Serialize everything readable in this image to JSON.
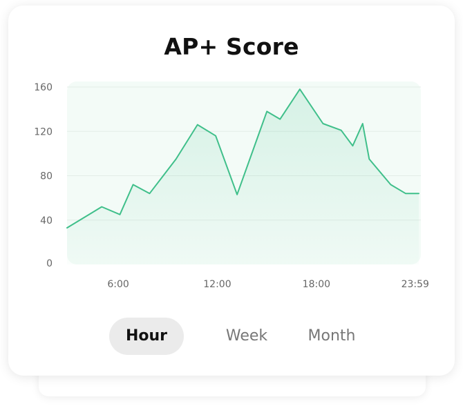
{
  "title": "AP+ Score",
  "tabs": [
    {
      "label": "Hour",
      "active": true
    },
    {
      "label": "Week",
      "active": false
    },
    {
      "label": "Month",
      "active": false
    }
  ],
  "colors": {
    "line": "#3fbf8a",
    "area": "#3fbf8a",
    "plot_bg": "#f3fbf7",
    "grid": "#e3ece7"
  },
  "chart_data": {
    "type": "area",
    "title": "AP+ Score",
    "xlabel": "",
    "ylabel": "",
    "ylim": [
      0,
      165
    ],
    "yticks": [
      0,
      40,
      80,
      120,
      160
    ],
    "ytick_labels": [
      "0",
      "40",
      "80",
      "120",
      "160"
    ],
    "xticks": [
      6,
      12,
      18,
      23.98
    ],
    "xtick_labels": [
      "6:00",
      "12:00",
      "18:00",
      "23:59"
    ],
    "xlim": [
      2.9,
      24.2
    ],
    "x": [
      2.9,
      5.0,
      6.1,
      6.9,
      7.9,
      9.5,
      10.8,
      11.9,
      13.2,
      15.0,
      15.8,
      17.0,
      18.4,
      19.5,
      20.2,
      20.8,
      21.2,
      22.5,
      23.4,
      24.2
    ],
    "series": [
      {
        "values": [
          33,
          52,
          45,
          72,
          64,
          95,
          126,
          116,
          63,
          138,
          131,
          158,
          127,
          121,
          107,
          127,
          95,
          72,
          64,
          64
        ]
      }
    ],
    "grid": true,
    "legend": "none"
  }
}
